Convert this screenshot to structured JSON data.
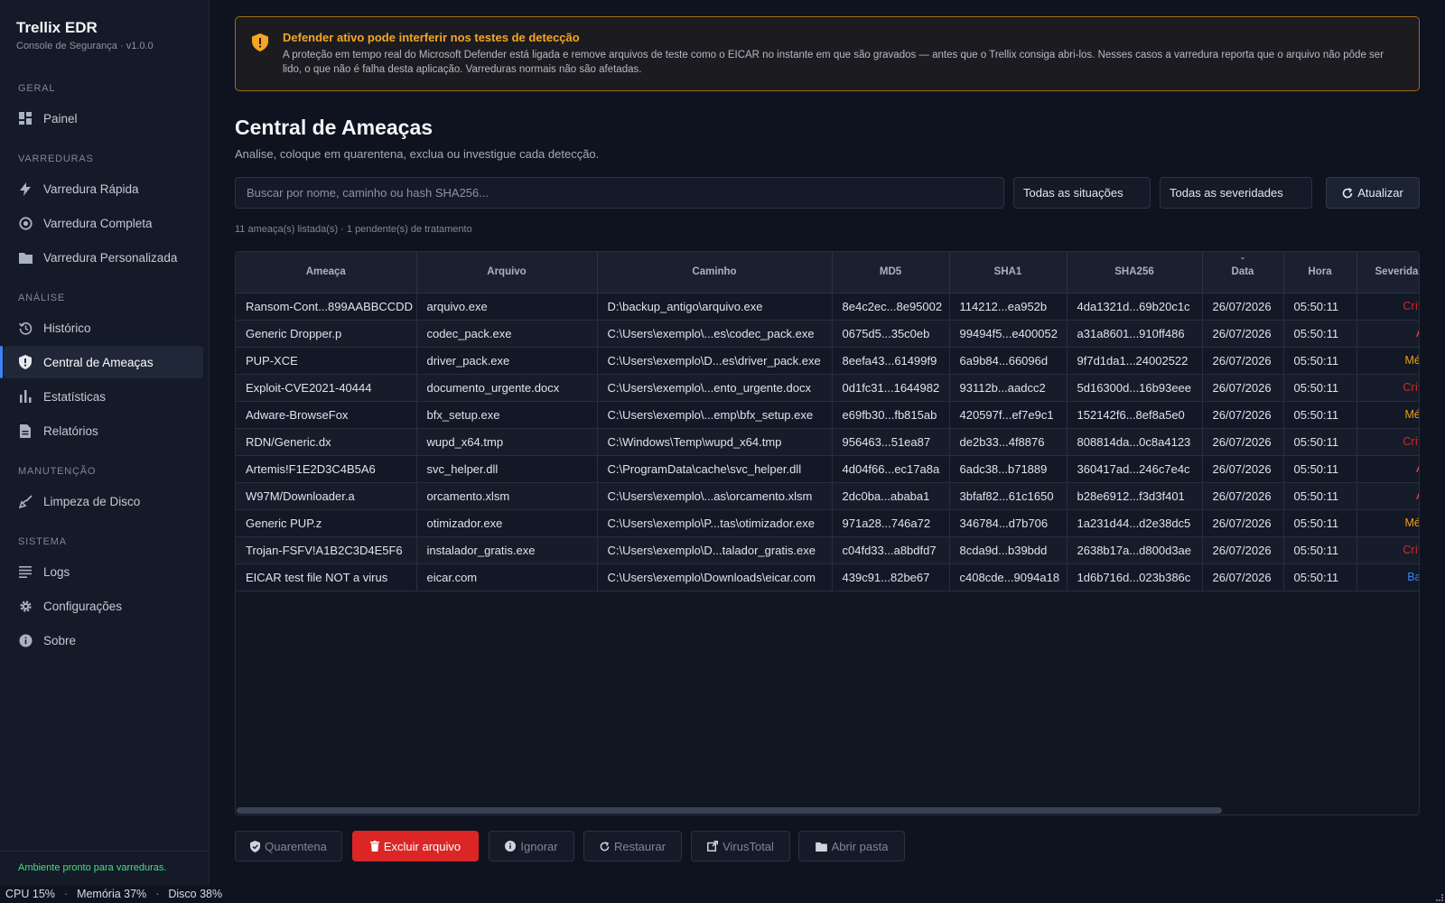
{
  "brand": {
    "title": "Trellix EDR",
    "subtitle": "Console de Segurança · v1.0.0"
  },
  "nav": {
    "sections": [
      {
        "label": "GERAL",
        "items": [
          {
            "label": "Painel",
            "icon": "dashboard-icon"
          }
        ]
      },
      {
        "label": "VARREDURAS",
        "items": [
          {
            "label": "Varredura Rápida",
            "icon": "bolt-icon"
          },
          {
            "label": "Varredura Completa",
            "icon": "target-icon"
          },
          {
            "label": "Varredura Personalizada",
            "icon": "folder-icon"
          }
        ]
      },
      {
        "label": "ANÁLISE",
        "items": [
          {
            "label": "Histórico",
            "icon": "history-icon"
          },
          {
            "label": "Central de Ameaças",
            "icon": "shield-icon",
            "active": true
          },
          {
            "label": "Estatísticas",
            "icon": "bar-chart-icon"
          },
          {
            "label": "Relatórios",
            "icon": "document-icon"
          }
        ]
      },
      {
        "label": "MANUTENÇÃO",
        "items": [
          {
            "label": "Limpeza de Disco",
            "icon": "broom-icon"
          }
        ]
      },
      {
        "label": "SISTEMA",
        "items": [
          {
            "label": "Logs",
            "icon": "list-icon"
          },
          {
            "label": "Configurações",
            "icon": "gear-icon"
          },
          {
            "label": "Sobre",
            "icon": "info-icon"
          }
        ]
      }
    ],
    "status": "Ambiente pronto para varreduras."
  },
  "alert": {
    "title": "Defender ativo pode interferir nos testes de detecção",
    "text": "A proteção em tempo real do Microsoft Defender está ligada e remove arquivos de teste como o EICAR no instante em que são gravados — antes que o Trellix consiga abri-los. Nesses casos a varredura reporta que o arquivo não pôde ser lido, o que não é falha desta aplicação. Varreduras normais não são afetadas."
  },
  "page": {
    "title": "Central de Ameaças",
    "subtitle": "Analise, coloque em quarentena, exclua ou investigue cada detecção."
  },
  "filters": {
    "search_placeholder": "Buscar por nome, caminho ou hash SHA256...",
    "status_select": "Todas as situações",
    "severity_select": "Todas as severidades",
    "refresh_label": "Atualizar"
  },
  "count_text": "11 ameaça(s) listada(s) · 1 pendente(s) de tratamento",
  "table": {
    "columns": [
      "Ameaça",
      "Arquivo",
      "Caminho",
      "MD5",
      "SHA1",
      "SHA256",
      "Data",
      "Hora",
      "Severidade"
    ],
    "rows": [
      [
        "Ransom-Cont...899AABBCCDD",
        "arquivo.exe",
        "D:\\backup_antigo\\arquivo.exe",
        "8e4c2ec...8e95002",
        "114212...ea952b",
        "4da1321d...69b20c1c",
        "26/07/2026",
        "05:50:11",
        "Crítica"
      ],
      [
        "Generic Dropper.p",
        "codec_pack.exe",
        "C:\\Users\\exemplo\\...es\\codec_pack.exe",
        "0675d5...35c0eb",
        "99494f5...e400052",
        "a31a8601...910ff486",
        "26/07/2026",
        "05:50:11",
        "Alta"
      ],
      [
        "PUP-XCE",
        "driver_pack.exe",
        "C:\\Users\\exemplo\\D...es\\driver_pack.exe",
        "8eefa43...61499f9",
        "6a9b84...66096d",
        "9f7d1da1...24002522",
        "26/07/2026",
        "05:50:11",
        "Média"
      ],
      [
        "Exploit-CVE2021-40444",
        "documento_urgente.docx",
        "C:\\Users\\exemplo\\...ento_urgente.docx",
        "0d1fc31...1644982",
        "93112b...aadcc2",
        "5d16300d...16b93eee",
        "26/07/2026",
        "05:50:11",
        "Crítica"
      ],
      [
        "Adware-BrowseFox",
        "bfx_setup.exe",
        "C:\\Users\\exemplo\\...emp\\bfx_setup.exe",
        "e69fb30...fb815ab",
        "420597f...ef7e9c1",
        "152142f6...8ef8a5e0",
        "26/07/2026",
        "05:50:11",
        "Média"
      ],
      [
        "RDN/Generic.dx",
        "wupd_x64.tmp",
        "C:\\Windows\\Temp\\wupd_x64.tmp",
        "956463...51ea87",
        "de2b33...4f8876",
        "808814da...0c8a4123",
        "26/07/2026",
        "05:50:11",
        "Crítica"
      ],
      [
        "Artemis!F1E2D3C4B5A6",
        "svc_helper.dll",
        "C:\\ProgramData\\cache\\svc_helper.dll",
        "4d04f66...ec17a8a",
        "6adc38...b71889",
        "360417ad...246c7e4c",
        "26/07/2026",
        "05:50:11",
        "Alta"
      ],
      [
        "W97M/Downloader.a",
        "orcamento.xlsm",
        "C:\\Users\\exemplo\\...as\\orcamento.xlsm",
        "2dc0ba...ababa1",
        "3bfaf82...61c1650",
        "b28e6912...f3d3f401",
        "26/07/2026",
        "05:50:11",
        "Alta"
      ],
      [
        "Generic PUP.z",
        "otimizador.exe",
        "C:\\Users\\exemplo\\P...tas\\otimizador.exe",
        "971a28...746a72",
        "346784...d7b706",
        "1a231d44...d2e38dc5",
        "26/07/2026",
        "05:50:11",
        "Média"
      ],
      [
        "Trojan-FSFV!A1B2C3D4E5F6",
        "instalador_gratis.exe",
        "C:\\Users\\exemplo\\D...talador_gratis.exe",
        "c04fd33...a8bdfd7",
        "8cda9d...b39bdd",
        "2638b17a...d800d3ae",
        "26/07/2026",
        "05:50:11",
        "Crítica"
      ],
      [
        "EICAR test file NOT a virus",
        "eicar.com",
        "C:\\Users\\exemplo\\Downloads\\eicar.com",
        "439c91...82be67",
        "c408cde...9094a18",
        "1d6b716d...023b386c",
        "26/07/2026",
        "05:50:11",
        "Baixa"
      ]
    ],
    "severity_colors": {
      "Crítica": "#dc2626",
      "Alta": "#ef4444",
      "Média": "#f59e0b",
      "Baixa": "#3b82f6"
    }
  },
  "actions": {
    "quarantine": "Quarentena",
    "delete": "Excluir arquivo",
    "ignore": "Ignorar",
    "restore": "Restaurar",
    "virustotal": "VirusTotal",
    "open_folder": "Abrir pasta"
  },
  "statusbar": {
    "cpu": "CPU 15%",
    "memory": "Memória 37%",
    "disk": "Disco 38%"
  },
  "colors": {
    "accent": "#3b82f6",
    "warning": "#f5a524",
    "danger": "#dc2626",
    "ok": "#4ade80"
  }
}
